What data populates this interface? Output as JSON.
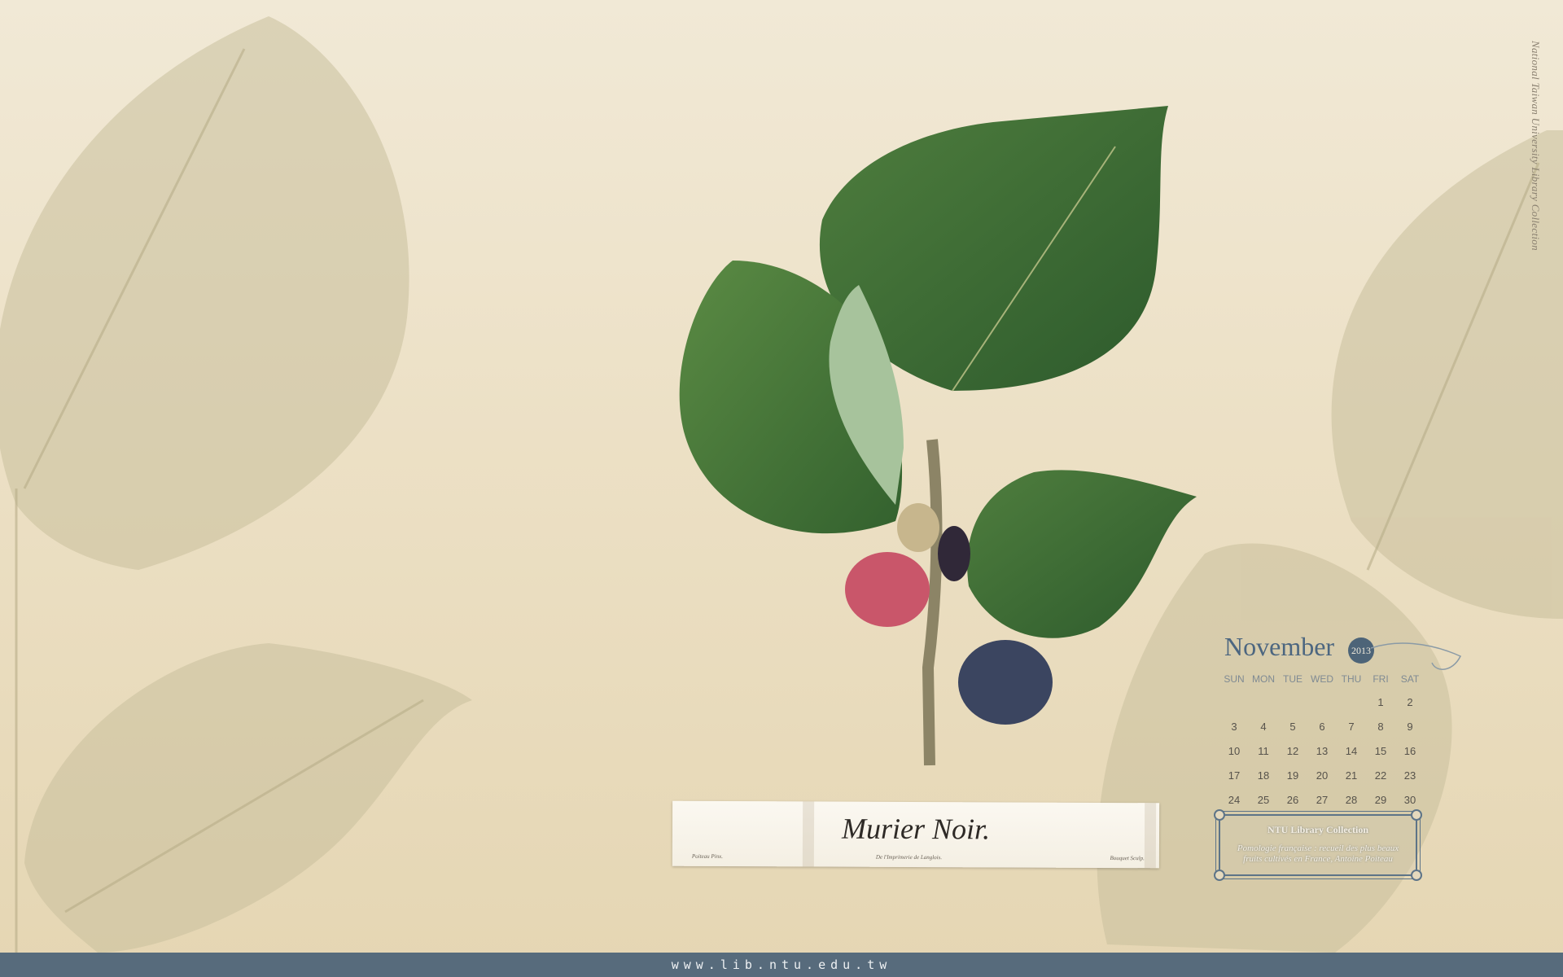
{
  "credit_vertical": "National Taiwan University Library Collection",
  "caption": {
    "title": "Murier Noir.",
    "painter": "Poiteau Pinx.",
    "printer": "De l'Imprimerie de Langlois.",
    "engraver": "Bouquet Sculp."
  },
  "calendar": {
    "month": "November",
    "year": "2013",
    "day_names": [
      "SUN",
      "MON",
      "TUE",
      "WED",
      "THU",
      "FRI",
      "SAT"
    ],
    "weeks": [
      [
        "",
        "",
        "",
        "",
        "",
        "1",
        "2"
      ],
      [
        "3",
        "4",
        "5",
        "6",
        "7",
        "8",
        "9"
      ],
      [
        "10",
        "11",
        "12",
        "13",
        "14",
        "15",
        "16"
      ],
      [
        "17",
        "18",
        "19",
        "20",
        "21",
        "22",
        "23"
      ],
      [
        "24",
        "25",
        "26",
        "27",
        "28",
        "29",
        "30"
      ]
    ]
  },
  "collection": {
    "title": "NTU Library Collection",
    "description_line1": "Pomologie française : recueil des plus beaux",
    "description_line2": "fruits cultivés en France, Antoine Poiteau"
  },
  "footer": {
    "url": "www.lib.ntu.edu.tw"
  },
  "colors": {
    "accent": "#4d6478",
    "footer_bar": "#576b7c",
    "leaf_green": "#3f6a35"
  }
}
